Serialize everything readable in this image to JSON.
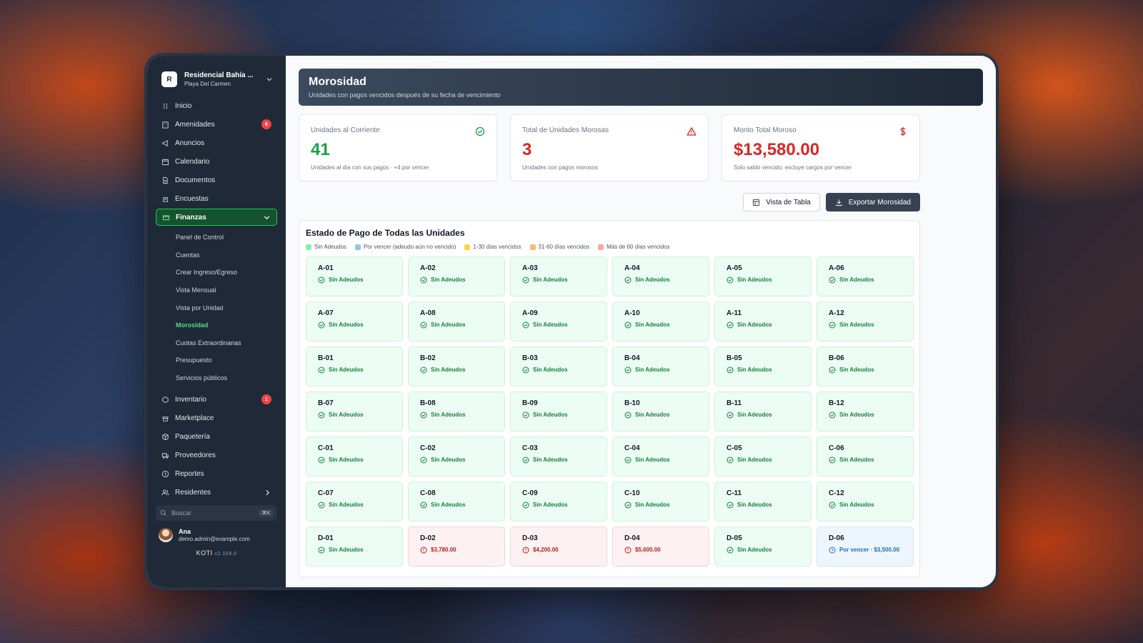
{
  "org": {
    "logo_letter": "R",
    "name": "Residencial Bahía ...",
    "location": "Playa Del Carmen"
  },
  "nav": [
    {
      "label": "Inicio",
      "icon": "home-icon"
    },
    {
      "label": "Amenidades",
      "icon": "building-icon",
      "badge": "6"
    },
    {
      "label": "Anuncios",
      "icon": "megaphone-icon"
    },
    {
      "label": "Calendario",
      "icon": "calendar-icon"
    },
    {
      "label": "Documentos",
      "icon": "document-icon"
    },
    {
      "label": "Encuestas",
      "icon": "poll-icon"
    },
    {
      "label": "Finanzas",
      "icon": "wallet-icon",
      "active": true
    }
  ],
  "finanzas_sub": [
    "Panel de Control",
    "Cuentas",
    "Crear Ingreso/Egreso",
    "Vista Mensual",
    "Vista por Unidad",
    "Morosidad",
    "Cuotas Extraordinarias",
    "Presupuesto",
    "Servicios públicos"
  ],
  "nav_bottom": [
    {
      "label": "Inventario",
      "icon": "inventory-icon",
      "badge": "1"
    },
    {
      "label": "Marketplace",
      "icon": "store-icon"
    },
    {
      "label": "Paquetería",
      "icon": "package-icon"
    },
    {
      "label": "Proveedores",
      "icon": "truck-icon"
    },
    {
      "label": "Reportes",
      "icon": "report-icon"
    },
    {
      "label": "Residentes",
      "icon": "users-icon"
    }
  ],
  "search": {
    "placeholder": "Buscar",
    "shortcut": "⌘K"
  },
  "user": {
    "name": "Ana",
    "email": "demo.admin@example.com"
  },
  "brand": {
    "name": "KOTI",
    "version": "v2.104.0"
  },
  "header": {
    "title": "Morosidad",
    "subtitle": "Unidades con pagos vencidos después de su fecha de vencimiento"
  },
  "cards": [
    {
      "label": "Unidades al Corriente",
      "value": "41",
      "note": "Unidades al día con sus pagos · +4 por vencer",
      "color": "#16a34a",
      "icon": "check-circle-icon"
    },
    {
      "label": "Total de Unidades Morosas",
      "value": "3",
      "note": "Unidades con pagos morosos",
      "color": "#dc2626",
      "icon": "warning-icon"
    },
    {
      "label": "Monto Total Moroso",
      "value": "$13,580.00",
      "note": "Solo saldo vencido; excluye cargos por vencer",
      "color": "#dc2626",
      "icon": "dollar-icon"
    }
  ],
  "actions": {
    "table_view": "Vista de Tabla",
    "export": "Exportar Morosidad"
  },
  "panel": {
    "title": "Estado de Pago de Todas las Unidades"
  },
  "legend": [
    {
      "label": "Sin Adeudos",
      "color": "#86efac"
    },
    {
      "label": "Por vencer (adeudo aún no vencido)",
      "color": "#93c5fd"
    },
    {
      "label": "1-30 días vencidos",
      "color": "#fcd34d"
    },
    {
      "label": "31-60 días vencidos",
      "color": "#fdba74"
    },
    {
      "label": "Más de 60 días vencidos",
      "color": "#fca5a5"
    }
  ],
  "units": [
    {
      "id": "A-01",
      "status": "Sin Adeudos",
      "state": "ok"
    },
    {
      "id": "A-02",
      "status": "Sin Adeudos",
      "state": "ok"
    },
    {
      "id": "A-03",
      "status": "Sin Adeudos",
      "state": "ok"
    },
    {
      "id": "A-04",
      "status": "Sin Adeudos",
      "state": "ok"
    },
    {
      "id": "A-05",
      "status": "Sin Adeudos",
      "state": "ok"
    },
    {
      "id": "A-06",
      "status": "Sin Adeudos",
      "state": "ok"
    },
    {
      "id": "A-07",
      "status": "Sin Adeudos",
      "state": "ok"
    },
    {
      "id": "A-08",
      "status": "Sin Adeudos",
      "state": "ok"
    },
    {
      "id": "A-09",
      "status": "Sin Adeudos",
      "state": "ok"
    },
    {
      "id": "A-10",
      "status": "Sin Adeudos",
      "state": "ok"
    },
    {
      "id": "A-11",
      "status": "Sin Adeudos",
      "state": "ok"
    },
    {
      "id": "A-12",
      "status": "Sin Adeudos",
      "state": "ok"
    },
    {
      "id": "B-01",
      "status": "Sin Adeudos",
      "state": "ok"
    },
    {
      "id": "B-02",
      "status": "Sin Adeudos",
      "state": "ok"
    },
    {
      "id": "B-03",
      "status": "Sin Adeudos",
      "state": "ok"
    },
    {
      "id": "B-04",
      "status": "Sin Adeudos",
      "state": "ok"
    },
    {
      "id": "B-05",
      "status": "Sin Adeudos",
      "state": "ok"
    },
    {
      "id": "B-06",
      "status": "Sin Adeudos",
      "state": "ok"
    },
    {
      "id": "B-07",
      "status": "Sin Adeudos",
      "state": "ok"
    },
    {
      "id": "B-08",
      "status": "Sin Adeudos",
      "state": "ok"
    },
    {
      "id": "B-09",
      "status": "Sin Adeudos",
      "state": "ok"
    },
    {
      "id": "B-10",
      "status": "Sin Adeudos",
      "state": "ok"
    },
    {
      "id": "B-11",
      "status": "Sin Adeudos",
      "state": "ok"
    },
    {
      "id": "B-12",
      "status": "Sin Adeudos",
      "state": "ok"
    },
    {
      "id": "C-01",
      "status": "Sin Adeudos",
      "state": "ok"
    },
    {
      "id": "C-02",
      "status": "Sin Adeudos",
      "state": "ok"
    },
    {
      "id": "C-03",
      "status": "Sin Adeudos",
      "state": "ok"
    },
    {
      "id": "C-04",
      "status": "Sin Adeudos",
      "state": "ok"
    },
    {
      "id": "C-05",
      "status": "Sin Adeudos",
      "state": "ok"
    },
    {
      "id": "C-06",
      "status": "Sin Adeudos",
      "state": "ok"
    },
    {
      "id": "C-07",
      "status": "Sin Adeudos",
      "state": "ok"
    },
    {
      "id": "C-08",
      "status": "Sin Adeudos",
      "state": "ok"
    },
    {
      "id": "C-09",
      "status": "Sin Adeudos",
      "state": "ok"
    },
    {
      "id": "C-10",
      "status": "Sin Adeudos",
      "state": "ok"
    },
    {
      "id": "C-11",
      "status": "Sin Adeudos",
      "state": "ok"
    },
    {
      "id": "C-12",
      "status": "Sin Adeudos",
      "state": "ok"
    },
    {
      "id": "D-01",
      "status": "Sin Adeudos",
      "state": "ok"
    },
    {
      "id": "D-02",
      "status": "$3,780.00",
      "state": "owed"
    },
    {
      "id": "D-03",
      "status": "$4,200.00",
      "state": "owed"
    },
    {
      "id": "D-04",
      "status": "$5,600.00",
      "state": "owed"
    },
    {
      "id": "D-05",
      "status": "Sin Adeudos",
      "state": "ok"
    },
    {
      "id": "D-06",
      "status": "Por vencer · $3,500.00",
      "state": "due"
    }
  ]
}
